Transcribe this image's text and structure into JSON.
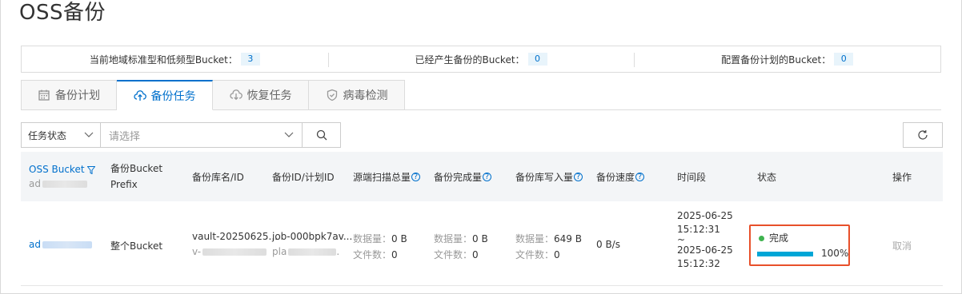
{
  "page_title": "OSS备份",
  "stats": [
    {
      "label": "当前地域标准型和低频型Bucket：",
      "value": "3"
    },
    {
      "label": "已经产生备份的Bucket：",
      "value": "0"
    },
    {
      "label": "配置备份计划的Bucket：",
      "value": "0"
    }
  ],
  "tabs": [
    {
      "label": "备份计划",
      "icon": "calendar-icon"
    },
    {
      "label": "备份任务",
      "icon": "cloud-upload-icon"
    },
    {
      "label": "恢复任务",
      "icon": "cloud-download-icon"
    },
    {
      "label": "病毒检测",
      "icon": "shield-check-icon"
    }
  ],
  "active_tab": "备份任务",
  "filter": {
    "field_label": "任务状态",
    "placeholder": "请选择"
  },
  "table": {
    "headers": {
      "bucket": "OSS Bucket",
      "bucket_sub": "ad",
      "prefix": "备份Bucket Prefix",
      "vault": "备份库名/ID",
      "job": "备份ID/计划ID",
      "scanned": "源端扫描总量",
      "completed": "备份完成量",
      "written": "备份库写入量",
      "speed": "备份速度",
      "period": "时间段",
      "status": "状态",
      "action": "操作"
    },
    "rows": [
      {
        "bucket": "ad",
        "prefix": "整个Bucket",
        "vault_name": "vault-20250625...",
        "vault_id": "v-",
        "job_id": "job-000bpk7av...",
        "plan_id": "pla",
        "completed_data_label": "数据量：",
        "completed_data": "0 B",
        "completed_files_label": "文件数：",
        "completed_files": "0",
        "scanned_data_label": "数据量：",
        "scanned_data": "0 B",
        "scanned_files_label": "文件数：",
        "scanned_files": "0",
        "written_data_label": "数据量：",
        "written_data": "649 B",
        "written_files_label": "文件数：",
        "written_files": "0",
        "speed": "0 B/s",
        "start_date": "2025-06-25",
        "start_time": "15:12:31",
        "tilde": "~",
        "end_date": "2025-06-25",
        "end_time": "15:12:32",
        "status": "完成",
        "status_color": "#3fb34f",
        "progress": 100,
        "progress_label": "100%",
        "action": "取消"
      }
    ]
  }
}
